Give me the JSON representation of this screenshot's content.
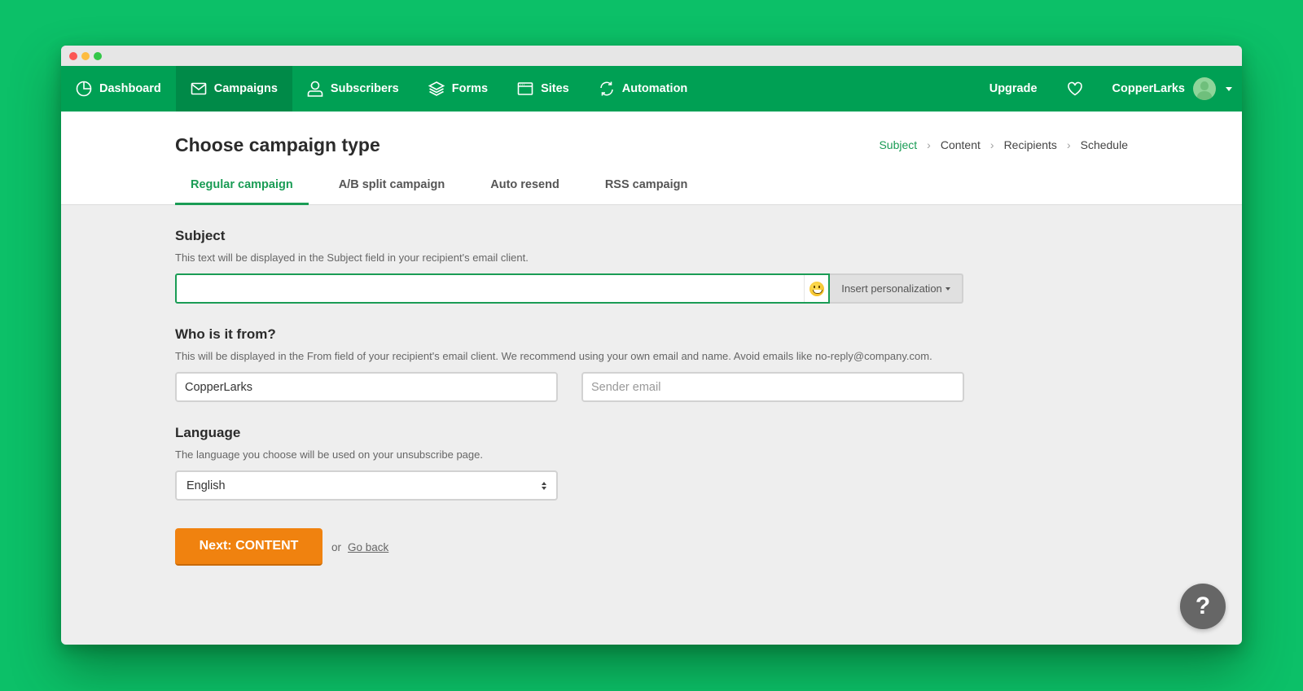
{
  "window": {
    "controls": [
      "close",
      "minimize",
      "maximize"
    ]
  },
  "nav": {
    "items": [
      {
        "label": "Dashboard",
        "icon": "dashboard-pie-icon",
        "active": false
      },
      {
        "label": "Campaigns",
        "icon": "envelope-icon",
        "active": true
      },
      {
        "label": "Subscribers",
        "icon": "user-icon",
        "active": false
      },
      {
        "label": "Forms",
        "icon": "layers-icon",
        "active": false
      },
      {
        "label": "Sites",
        "icon": "browser-window-icon",
        "active": false
      },
      {
        "label": "Automation",
        "icon": "refresh-icon",
        "active": false
      }
    ],
    "upgrade_label": "Upgrade",
    "favorites_icon": "heart-icon",
    "account_name": "CopperLarks"
  },
  "header": {
    "title": "Choose campaign type",
    "steps": [
      {
        "label": "Subject",
        "current": true
      },
      {
        "label": "Content",
        "current": false
      },
      {
        "label": "Recipients",
        "current": false
      },
      {
        "label": "Schedule",
        "current": false
      }
    ],
    "step_separator": ">",
    "tabs": [
      {
        "label": "Regular campaign",
        "active": true
      },
      {
        "label": "A/B split campaign",
        "active": false
      },
      {
        "label": "Auto resend",
        "active": false
      },
      {
        "label": "RSS campaign",
        "active": false
      }
    ]
  },
  "form": {
    "subject": {
      "title": "Subject",
      "description": "This text will be displayed in the Subject field in your recipient's email client.",
      "value": "",
      "placeholder": "",
      "emoji_icon": "smiley-emoji-icon",
      "personalization_label": "Insert personalization"
    },
    "from": {
      "title": "Who is it from?",
      "description": "This will be displayed in the From field of your recipient's email client. We recommend using your own email and name. Avoid emails like no-reply@company.com.",
      "name_value": "CopperLarks",
      "email_value": "",
      "email_placeholder": "Sender email"
    },
    "language": {
      "title": "Language",
      "description": "The language you choose will be used on your unsubscribe page.",
      "selected": "English"
    },
    "actions": {
      "next_label": "Next: CONTENT",
      "or_text": "or",
      "back_label": "Go back"
    }
  },
  "help": {
    "label": "?"
  },
  "colors": {
    "background": "#0cc068",
    "nav": "#00a054",
    "nav_active": "#008a48",
    "accent": "#1a9c55",
    "primary_button": "#f0820f",
    "help_button": "#666666"
  }
}
